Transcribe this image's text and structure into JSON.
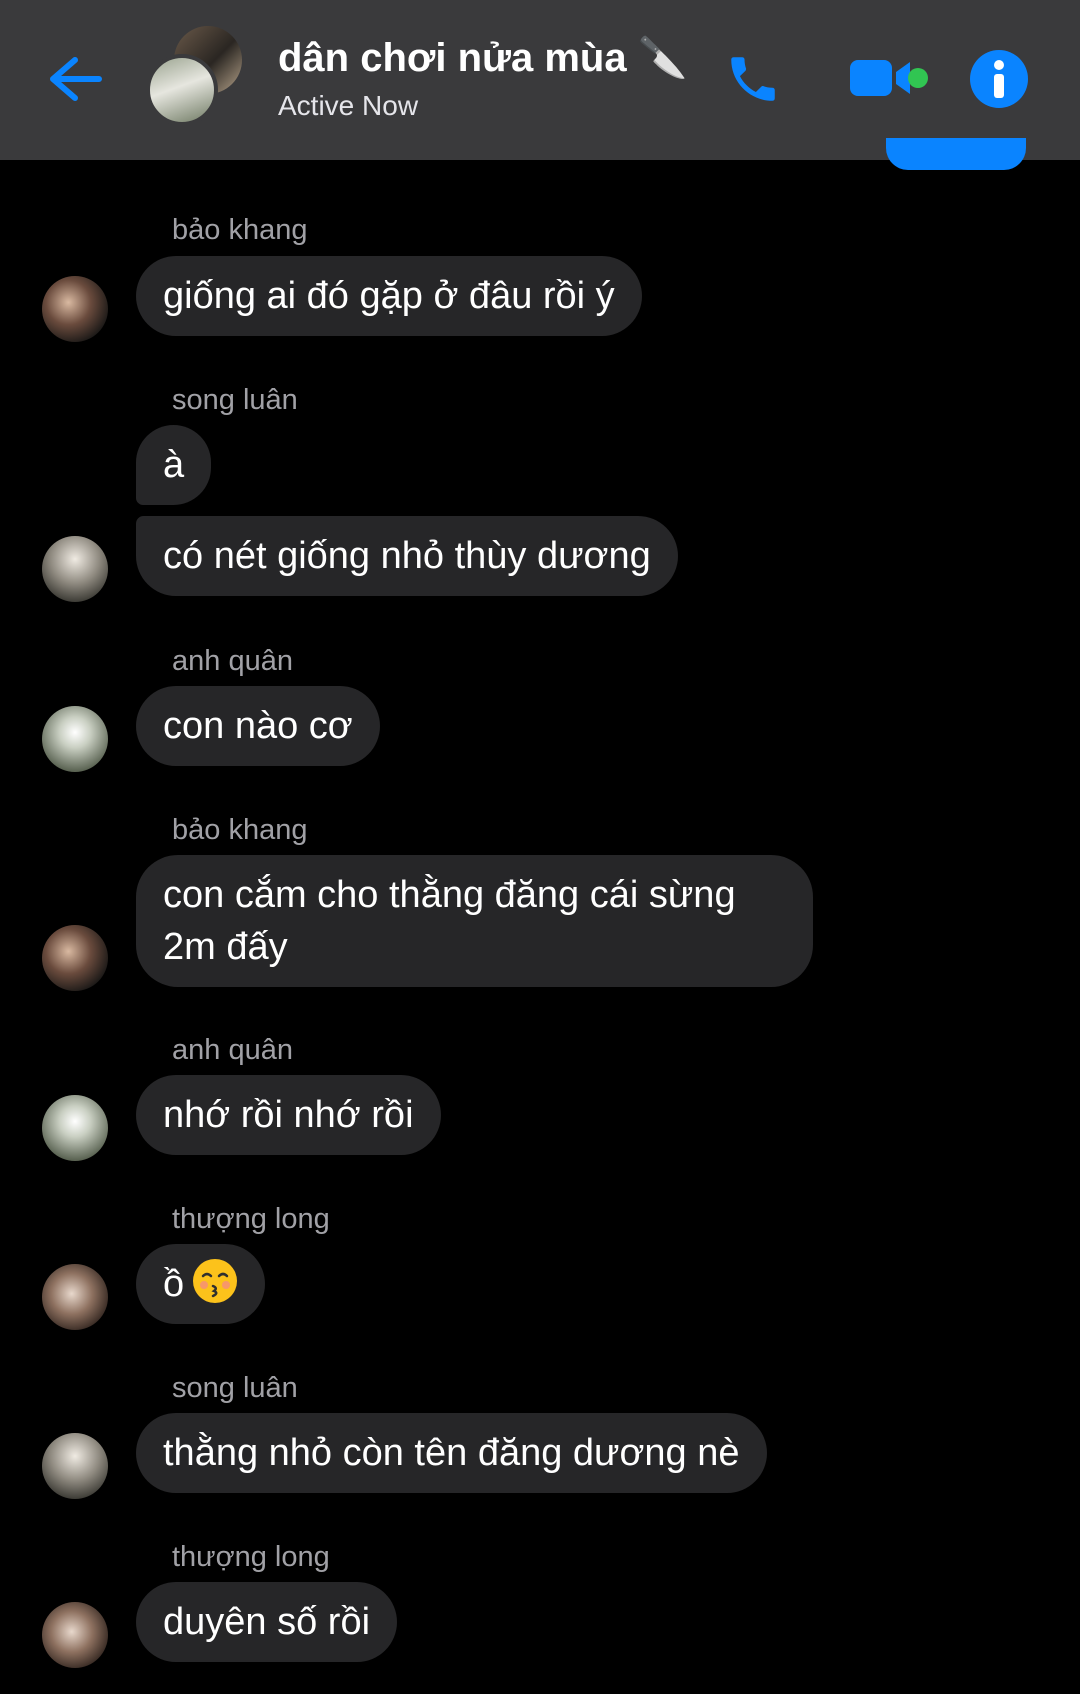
{
  "header": {
    "title": "dân chơi nửa mùa 🔪",
    "status": "Active Now",
    "icons": {
      "back": "back-arrow-icon",
      "call": "phone-icon",
      "video": "video-camera-icon",
      "info": "info-icon"
    },
    "accent_color": "#0a84ff",
    "online_color": "#31c552"
  },
  "messages": [
    {
      "sender": "bảo khang",
      "text": "giống ai đó gặp ở đâu rồi ý"
    },
    {
      "sender": "song luân",
      "text": "à"
    },
    {
      "sender": "",
      "text": "có nét giống nhỏ thùy dương"
    },
    {
      "sender": "anh quân",
      "text": "con nào cơ"
    },
    {
      "sender": "bảo khang",
      "text": "con cắm cho thằng đăng cái sừng 2m đấy"
    },
    {
      "sender": "anh quân",
      "text": "nhớ rồi nhớ rồi"
    },
    {
      "sender": "thượng long",
      "text": "ồ"
    },
    {
      "sender": "song luân",
      "text": "thằng nhỏ còn tên đăng dương nè"
    },
    {
      "sender": "thượng long",
      "text": "duyên số rồi"
    }
  ],
  "colors": {
    "background": "#000000",
    "header_bg": "#3a3a3c",
    "bubble_bg": "#262628",
    "sender_text": "#a1a1a6"
  }
}
